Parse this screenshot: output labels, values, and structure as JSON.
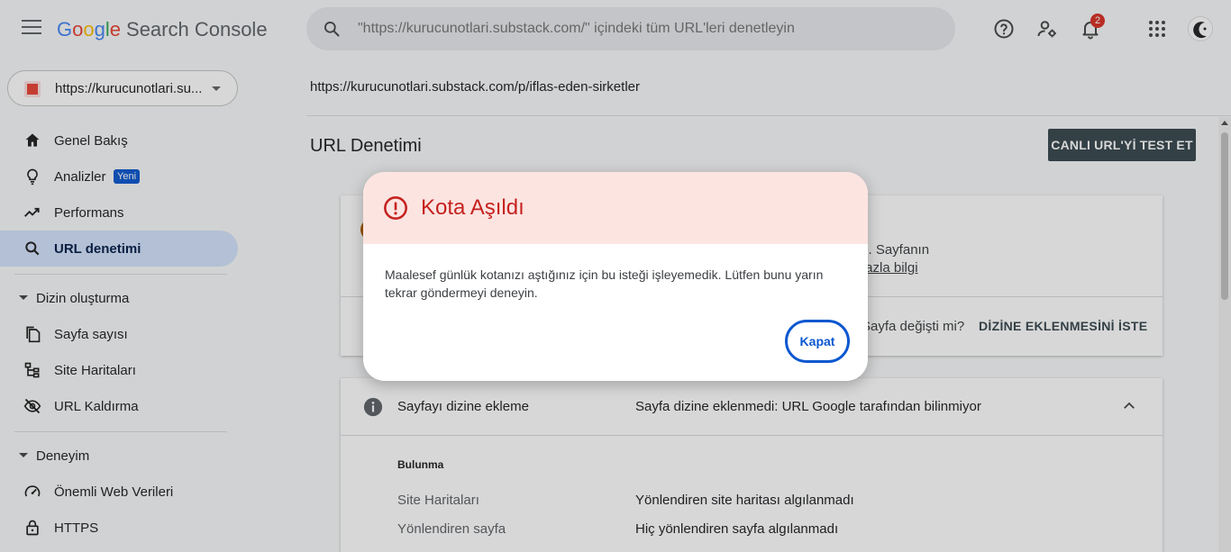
{
  "header": {
    "logo_google": [
      "G",
      "o",
      "o",
      "g",
      "l",
      "e"
    ],
    "logo_product": "Search Console",
    "search_placeholder": "\"https://kurucunotlari.substack.com/\" içindeki tüm URL'leri denetleyin",
    "notification_count": "2"
  },
  "sidebar": {
    "property": "https://kurucunotlari.su...",
    "items": [
      {
        "label": "Genel Bakış",
        "icon": "home-icon"
      },
      {
        "label": "Analizler",
        "icon": "lightbulb-icon",
        "badge": "Yeni"
      },
      {
        "label": "Performans",
        "icon": "trending-up-icon"
      },
      {
        "label": "URL denetimi",
        "icon": "search-icon",
        "active": true
      }
    ],
    "sections": [
      {
        "label": "Dizin oluşturma",
        "items": [
          {
            "label": "Sayfa sayısı",
            "icon": "pages-icon"
          },
          {
            "label": "Site Haritaları",
            "icon": "sitemap-icon"
          },
          {
            "label": "URL Kaldırma",
            "icon": "eye-off-icon"
          }
        ]
      },
      {
        "label": "Deneyim",
        "items": [
          {
            "label": "Önemli Web Verileri",
            "icon": "speed-icon"
          },
          {
            "label": "HTTPS",
            "icon": "lock-icon"
          }
        ]
      }
    ]
  },
  "main": {
    "url": "https://kurucunotlari.substack.com/p/iflas-eden-sirketler",
    "title": "URL Denetimi",
    "live_test_button": "CANLI URL'Yİ TEST ET",
    "card1": {
      "text1": "z. Sayfanın",
      "link": "fazla bilgi",
      "question": "Sayfa değişti mi?",
      "request_button": "DİZİNE EKLENMESİNİ İSTE"
    },
    "card2": {
      "label": "Sayfayı dizine ekleme",
      "status": "Sayfa dizine eklenmedi: URL Google tarafından bilinmiyor",
      "subheading": "Bulunma",
      "rows": [
        {
          "key": "Site Haritaları",
          "value": "Yönlendiren site haritası algılanmadı"
        },
        {
          "key": "Yönlendiren sayfa",
          "value": "Hiç yönlendiren sayfa algılanmadı"
        }
      ]
    }
  },
  "dialog": {
    "title": "Kota Aşıldı",
    "body": "Maalesef günlük kotanızı aştığınız için bu isteği işleyemedik. Lütfen bunu yarın tekrar göndermeyi deneyin.",
    "close_button": "Kapat"
  },
  "colors": {
    "accent": "#0b57d0",
    "error": "#c5221f",
    "dialog_header": "#fce4e1",
    "active_nav": "#d3e3fd",
    "dark_button": "#37474f"
  }
}
